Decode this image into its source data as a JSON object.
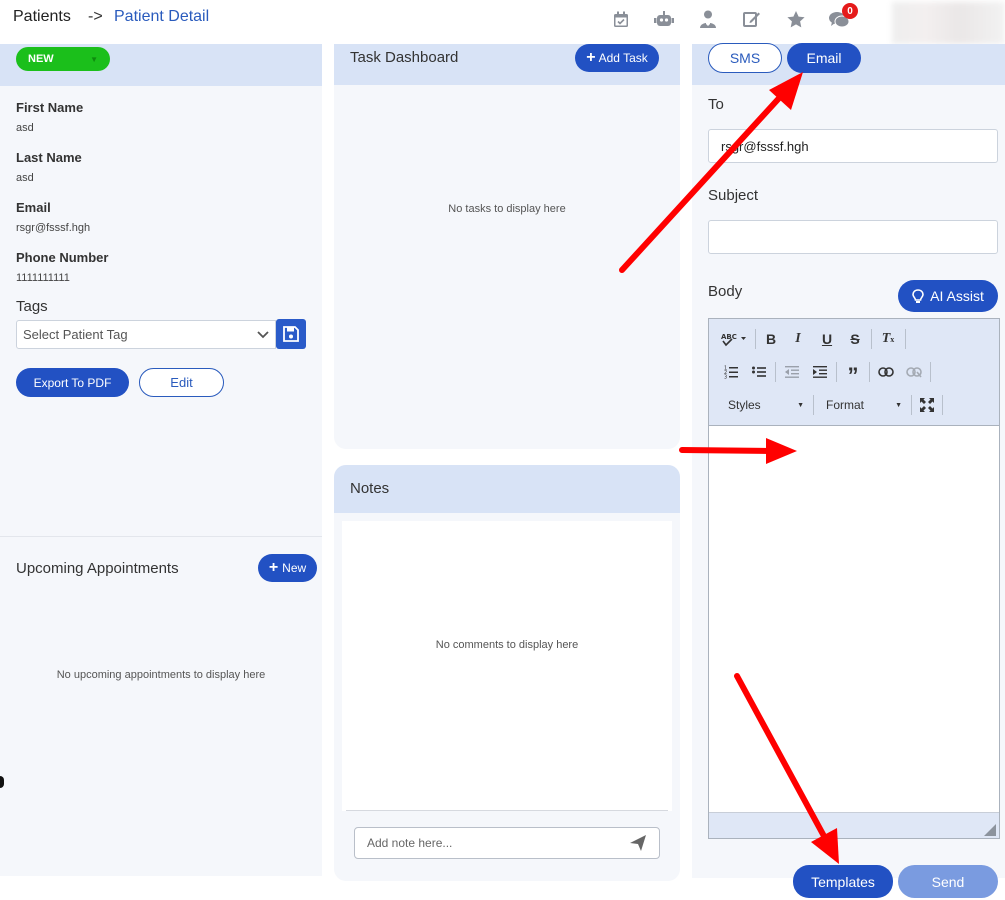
{
  "breadcrumb": {
    "root": "Patients",
    "separator": "->",
    "current": "Patient Detail"
  },
  "header": {
    "icons": [
      "calendar-check-icon",
      "robot-icon",
      "user-doctor-icon",
      "edit-icon",
      "star-icon",
      "chat-icon"
    ],
    "chat_badge": "0"
  },
  "patient": {
    "status": "NEW",
    "fields": [
      {
        "label": "First Name",
        "value": "asd"
      },
      {
        "label": "Last Name",
        "value": "asd"
      },
      {
        "label": "Email",
        "value": "rsgr@fsssf.hgh"
      },
      {
        "label": "Phone Number",
        "value": "1111111111"
      }
    ],
    "tags_label": "Tags",
    "tag_placeholder": "Select Patient Tag",
    "export_label": "Export To PDF",
    "edit_label": "Edit"
  },
  "appointments": {
    "title": "Upcoming Appointments",
    "new_label": "New",
    "empty": "No upcoming appointments to display here"
  },
  "tasks": {
    "title": "Task Dashboard",
    "add_label": "Add Task",
    "empty": "No tasks to display here"
  },
  "notes": {
    "title": "Notes",
    "empty": "No comments to display here",
    "input_placeholder": "Add note here..."
  },
  "message": {
    "tabs": {
      "sms": "SMS",
      "email": "Email",
      "active": "email"
    },
    "to_label": "To",
    "to_value": "rsgr@fsssf.hgh",
    "subject_label": "Subject",
    "subject_value": "",
    "body_label": "Body",
    "ai_assist_label": "AI Assist",
    "editor": {
      "row1": [
        "spellcheck-icon",
        "bold-icon",
        "italic-icon",
        "underline-icon",
        "strikethrough-icon",
        "remove-format-icon"
      ],
      "row2": [
        "numbered-list-icon",
        "bulleted-list-icon",
        "outdent-icon",
        "indent-icon",
        "blockquote-icon",
        "link-icon",
        "unlink-icon"
      ],
      "styles_label": "Styles",
      "format_label": "Format"
    },
    "templates_label": "Templates",
    "send_label": "Send"
  },
  "colors": {
    "primary": "#2251c3",
    "header_band": "#d8e3f6",
    "panel_bg": "#f5f7fb",
    "status_green": "#1bbf1b",
    "annotation_red": "#ff0000"
  }
}
